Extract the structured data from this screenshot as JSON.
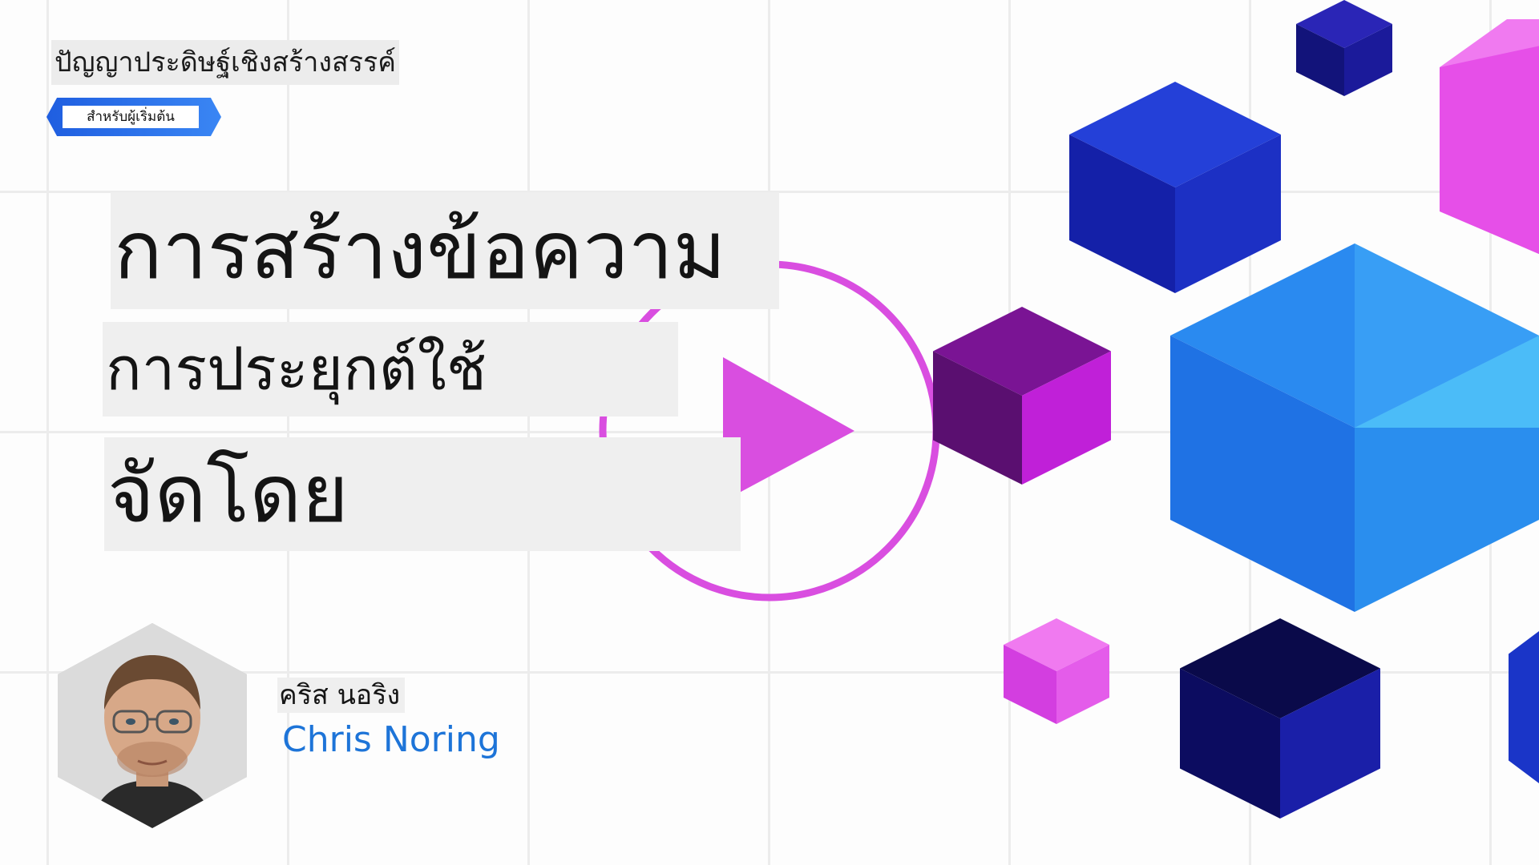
{
  "header": {
    "series_title": "ปัญญาประดิษฐ์เชิงสร้างสรรค์",
    "audience_badge": "สำหรับผู้เริ่มต้น"
  },
  "lesson": {
    "title_line1": "การสร้างข้อความ",
    "title_line2": "การประยุกต์ใช้",
    "title_line3": "จัดโดย"
  },
  "presenter": {
    "name_thai": "คริส นอริง",
    "name_en": "Chris Noring"
  },
  "icons": {
    "play": "play-icon"
  },
  "colors": {
    "accent_magenta": "#d94ee0",
    "accent_blue": "#1d74d8",
    "cube_blue": "#2f86ea",
    "cube_navy": "#14168a",
    "cube_purple": "#8a1c9c"
  }
}
